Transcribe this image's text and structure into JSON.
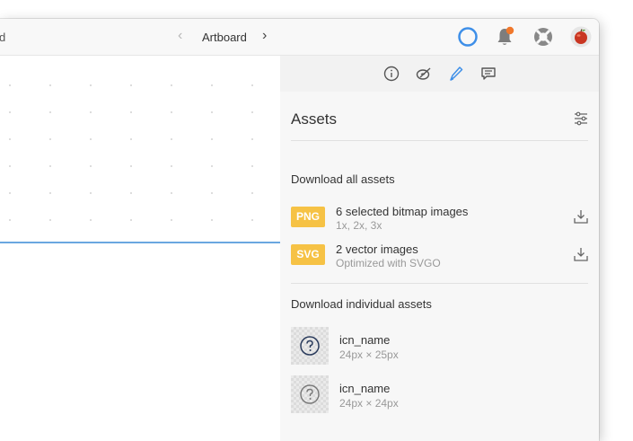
{
  "toolbar": {
    "left_fragment": "d",
    "artboard_title": "Artboard",
    "prev_icon": "chevron-left-icon",
    "next_icon": "chevron-right-icon",
    "right_icons": [
      "status-ring-icon",
      "notification-bell-icon",
      "help-lifebuoy-icon",
      "user-avatar"
    ]
  },
  "inspector_tabs": [
    "info-icon",
    "properties-icon",
    "code-pen-icon",
    "comments-icon"
  ],
  "assets": {
    "title": "Assets",
    "download_all_title": "Download all assets",
    "bundles": [
      {
        "badge": "PNG",
        "title": "6 selected bitmap images",
        "subtitle": "1x, 2x, 3x"
      },
      {
        "badge": "SVG",
        "title": "2 vector images",
        "subtitle": "Optimized with SVGO"
      }
    ],
    "individual_title": "Download individual assets",
    "items": [
      {
        "name": "icn_name",
        "size": "24px × 25px"
      },
      {
        "name": "icn_name",
        "size": "24px × 24px"
      }
    ]
  },
  "colors": {
    "accent_blue": "#3e8fe8",
    "badge_yellow": "#f6c245",
    "notification_orange": "#f0782c",
    "selection_line": "#6aa7e0"
  }
}
